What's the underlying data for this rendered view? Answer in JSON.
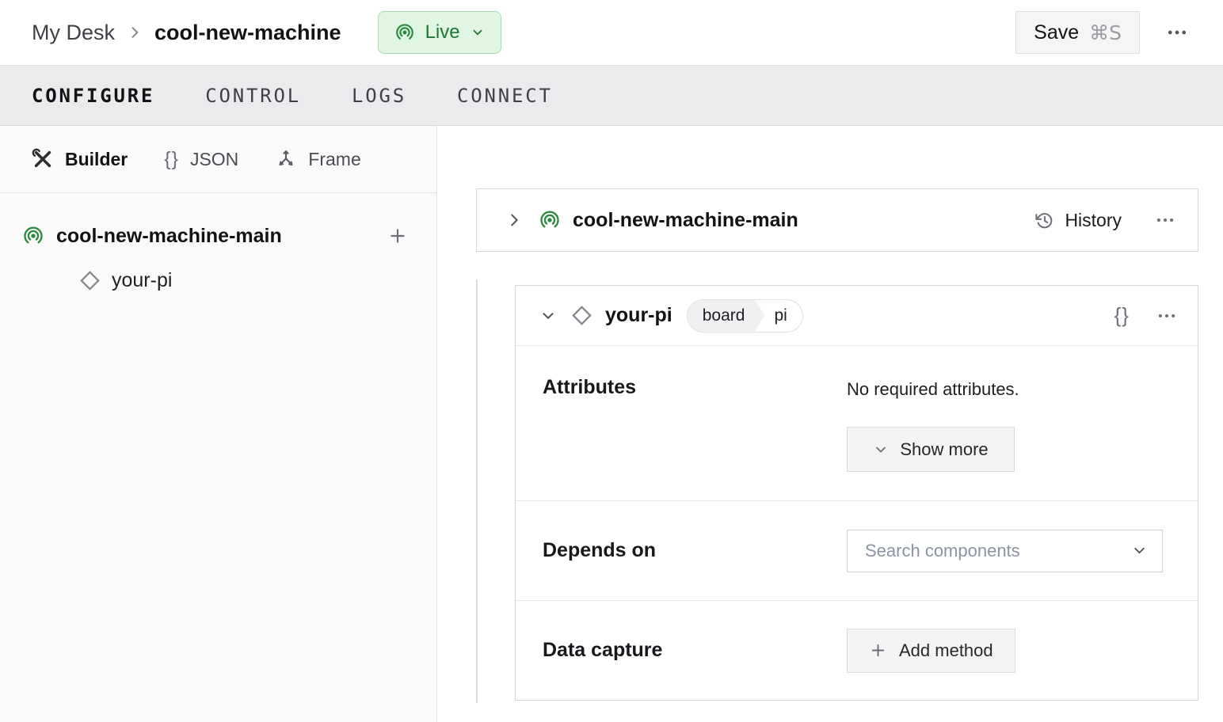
{
  "header": {
    "breadcrumb": {
      "parent": "My Desk",
      "current": "cool-new-machine"
    },
    "live_status": {
      "label": "Live"
    },
    "save": {
      "label": "Save",
      "shortcut": "⌘S"
    }
  },
  "nav_tabs": [
    {
      "label": "CONFIGURE",
      "active": true
    },
    {
      "label": "CONTROL",
      "active": false
    },
    {
      "label": "LOGS",
      "active": false
    },
    {
      "label": "CONNECT",
      "active": false
    }
  ],
  "sidebar": {
    "view_tabs": [
      {
        "label": "Builder",
        "active": true
      },
      {
        "label": "JSON",
        "active": false
      },
      {
        "label": "Frame",
        "active": false
      }
    ],
    "tree": {
      "root": "cool-new-machine-main",
      "child": "your-pi"
    }
  },
  "main": {
    "part_card": {
      "title": "cool-new-machine-main",
      "history": "History"
    },
    "component_card": {
      "title": "your-pi",
      "badge": {
        "type": "board",
        "model": "pi"
      },
      "attributes": {
        "label": "Attributes",
        "empty": "No required attributes.",
        "show_more": "Show more"
      },
      "depends_on": {
        "label": "Depends on",
        "placeholder": "Search components"
      },
      "data_capture": {
        "label": "Data capture",
        "add_method": "Add method"
      }
    }
  },
  "colors": {
    "accent_green": "#2c8a3e",
    "live_bg": "#e0f6e2",
    "live_border": "#a5dcae",
    "live_text": "#1f7534",
    "tab_bar_bg": "#ebebee",
    "sidebar_bg": "#fafafa",
    "button_bg": "#f4f4f5",
    "card_border": "#d7d7db",
    "divider": "#e6e6e9",
    "text_primary": "#131316",
    "icon_gray": "#6e6e78",
    "placeholder": "#8b93a3"
  }
}
